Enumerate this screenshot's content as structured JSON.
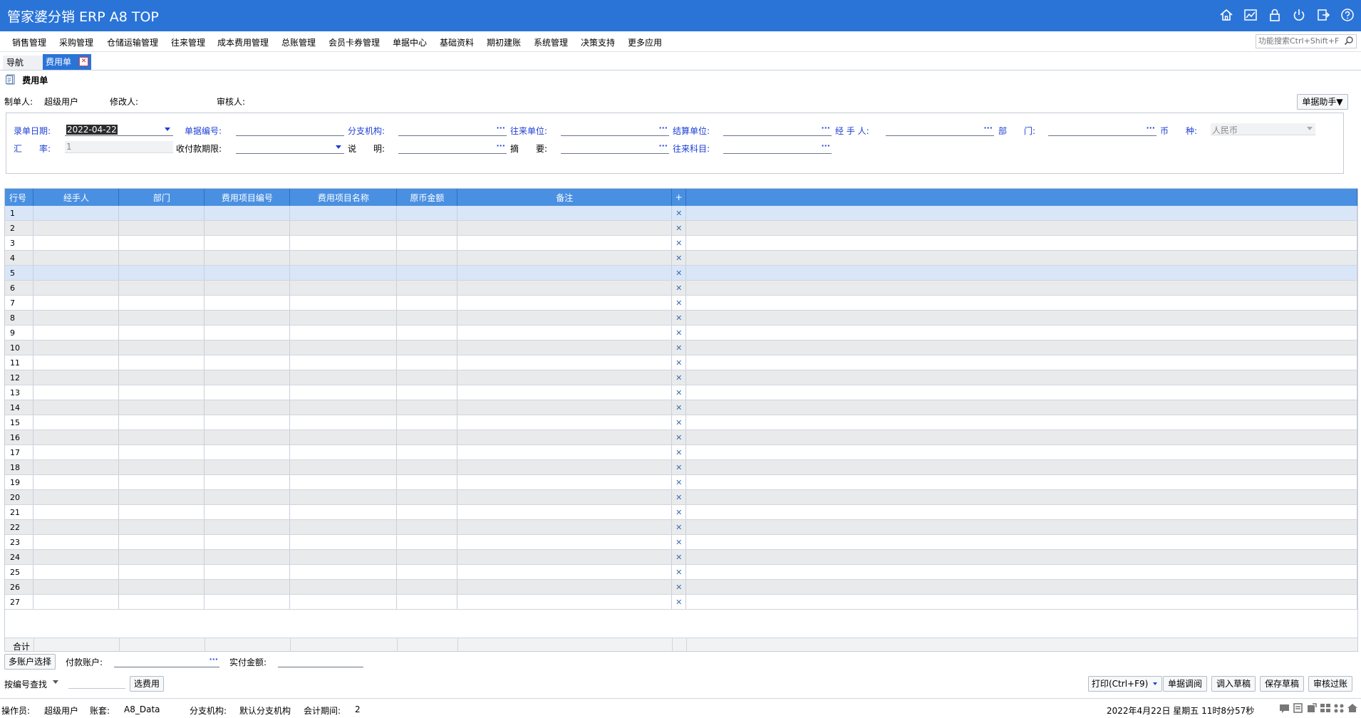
{
  "app": {
    "title": "管家婆分销 ERP A8 TOP"
  },
  "menu": {
    "items": [
      "销售管理",
      "采购管理",
      "仓储运输管理",
      "往来管理",
      "成本费用管理",
      "总账管理",
      "会员卡券管理",
      "单据中心",
      "基础资料",
      "期初建账",
      "系统管理",
      "决策支持",
      "更多应用"
    ],
    "search_placeholder": "功能搜索Ctrl+Shift+F"
  },
  "tabs": {
    "nav": "导航",
    "active": "费用单"
  },
  "doc": {
    "title": "费用单",
    "creator_label": "制单人:",
    "creator_value": "超级用户",
    "modifier_label": "修改人:",
    "reviewer_label": "审核人:",
    "helper_button": "单据助手▼"
  },
  "form": {
    "date_label": "录单日期:",
    "date_value": "2022-04-22",
    "number_label": "单据编号:",
    "branch_label": "分支机构:",
    "partner_label": "往来单位:",
    "settle_label": "结算单位:",
    "handler_label": "经 手 人:",
    "dept_label": "部　　门:",
    "currency_label": "币　　种:",
    "currency_value": "人民币",
    "rate_label": "汇　　率:",
    "rate_value": "1",
    "payterm_label": "收付款期限:",
    "note_label": "说　　明:",
    "summary_label": "摘　　要:",
    "account_label": "往来科目:"
  },
  "grid": {
    "columns": [
      "行号",
      "经手人",
      "部门",
      "费用项目编号",
      "费用项目名称",
      "原币金额",
      "备注",
      "+"
    ],
    "rows": [
      "1",
      "2",
      "3",
      "4",
      "5",
      "6",
      "7",
      "8",
      "9",
      "10",
      "11",
      "12",
      "13",
      "14",
      "15",
      "16",
      "17",
      "18",
      "19",
      "20",
      "21",
      "22",
      "23",
      "24",
      "25",
      "26",
      "27"
    ],
    "delete_glyph": "✕",
    "total_label": "合计"
  },
  "bottom": {
    "multi_account_button": "多账户选择",
    "pay_account_label": "付款账户:",
    "actual_paid_label": "实付金额:",
    "search_mode": "按编号查找",
    "select_fee_button": "选费用",
    "print_button": "打印(Ctrl+F9)",
    "adjust_button": "单据调阅",
    "load_draft_button": "调入草稿",
    "save_draft_button": "保存草稿",
    "post_button": "审核过账"
  },
  "status": {
    "operator_label": "操作员:",
    "operator_value": "超级用户",
    "book_label": "账套:",
    "book_value": "A8_Data",
    "branch_label": "分支机构:",
    "branch_value": "默认分支机构",
    "period_label": "会计期间:",
    "period_value": "2",
    "datetime": "2022年4月22日 星期五 11时8分57秒"
  },
  "colors": {
    "accent": "#2a74d8",
    "header": "#4a90e2",
    "label_blue": "#1b3fd6",
    "selected_row": "#d8e6f8"
  }
}
